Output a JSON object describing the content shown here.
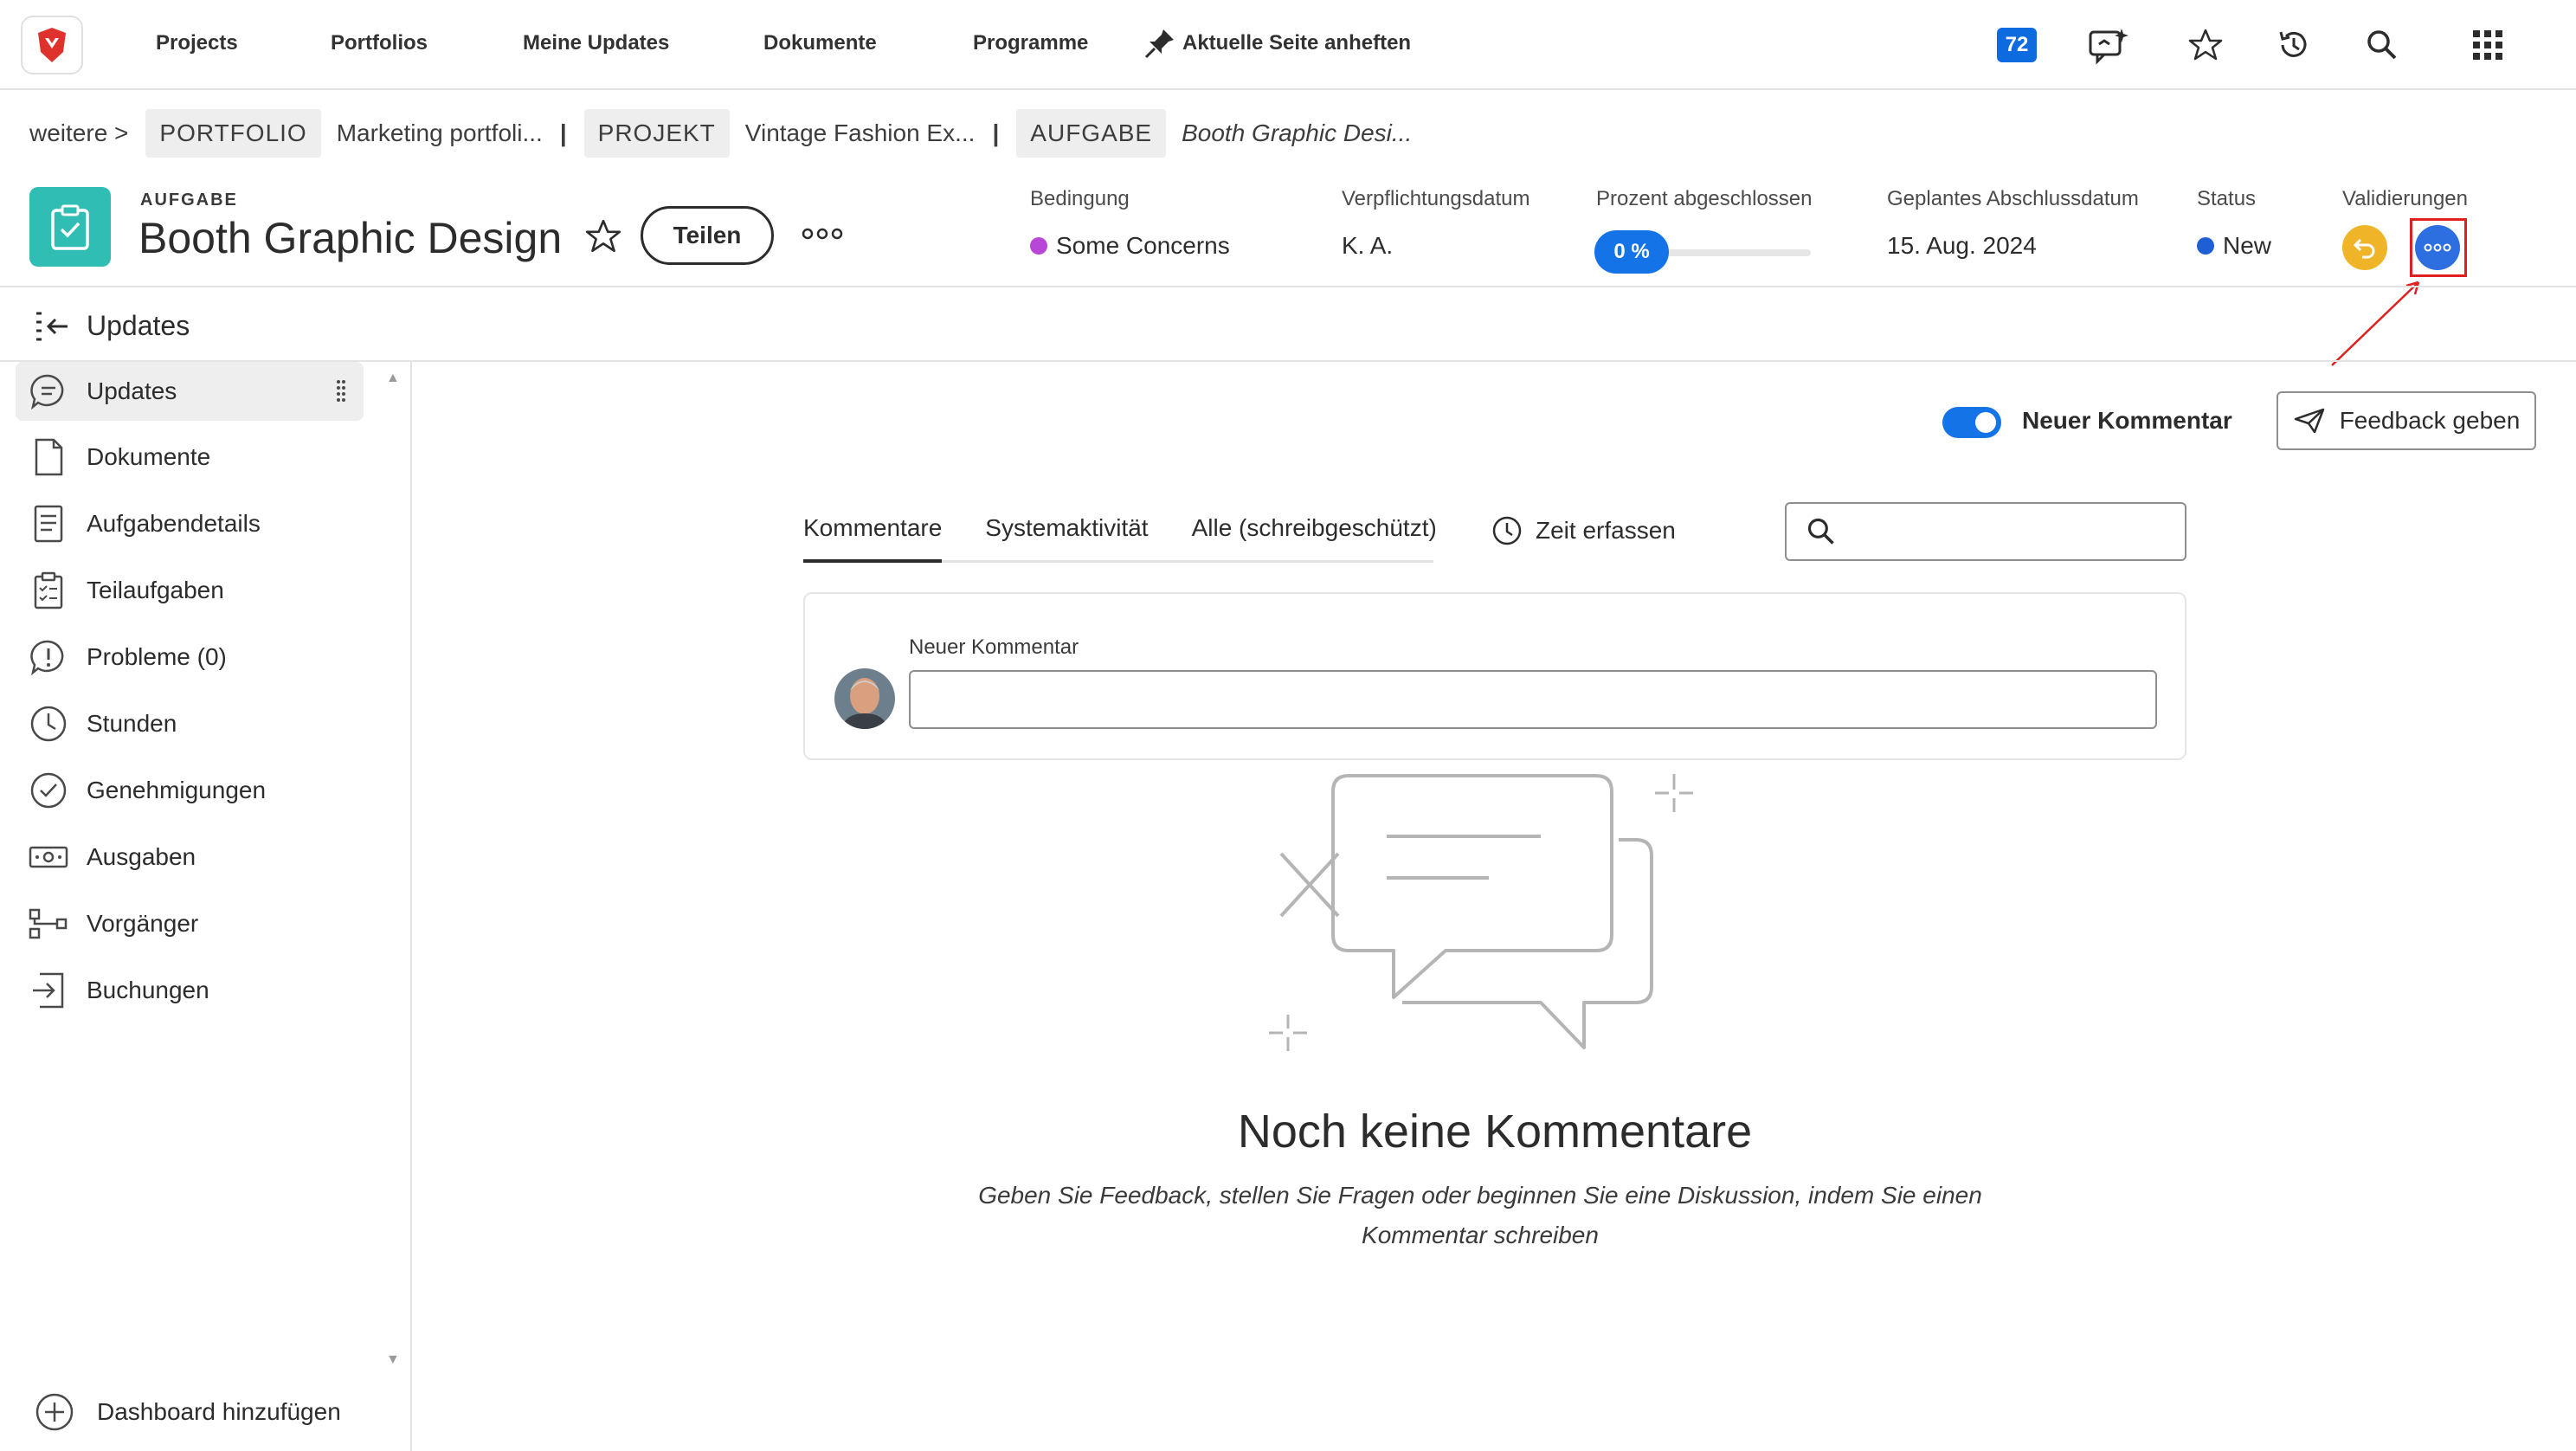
{
  "nav": {
    "links": [
      "Projects",
      "Portfolios",
      "Meine Updates",
      "Dokumente",
      "Programme"
    ],
    "pin_label": "Aktuelle Seite anheften",
    "notification_count": "72"
  },
  "breadcrumb": {
    "more": "weitere >",
    "portfolio_chip": "PORTFOLIO",
    "portfolio_name": "Marketing portfoli...",
    "project_chip": "PROJEKT",
    "project_name": "Vintage Fashion Ex...",
    "task_chip": "AUFGABE",
    "task_name": "Booth Graphic Desi..."
  },
  "header": {
    "kind": "AUFGABE",
    "title": "Booth Graphic Design",
    "share_label": "Teilen",
    "fields": {
      "condition_label": "Bedingung",
      "condition_value": "Some Concerns",
      "condition_color": "#b846d6",
      "commit_label": "Verpflichtungsdatum",
      "commit_value": "K. A.",
      "percent_label": "Prozent abgeschlossen",
      "percent_value": "0 %",
      "percent_fraction": 0,
      "planned_label": "Geplantes Abschlussdatum",
      "planned_value": "15. Aug. 2024",
      "status_label": "Status",
      "status_value": "New",
      "status_color": "#1f5fd6",
      "validations_label": "Validierungen"
    }
  },
  "updates_bar": {
    "title": "Updates"
  },
  "sidebar": {
    "items": [
      {
        "label": "Updates",
        "icon": "comment-icon"
      },
      {
        "label": "Dokumente",
        "icon": "document-icon"
      },
      {
        "label": "Aufgabendetails",
        "icon": "details-icon"
      },
      {
        "label": "Teilaufgaben",
        "icon": "subtasks-icon"
      },
      {
        "label": "Probleme (0)",
        "icon": "issue-icon"
      },
      {
        "label": "Stunden",
        "icon": "clock-icon"
      },
      {
        "label": "Genehmigungen",
        "icon": "approval-icon"
      },
      {
        "label": "Ausgaben",
        "icon": "expense-icon"
      },
      {
        "label": "Vorgänger",
        "icon": "predecessor-icon"
      },
      {
        "label": "Buchungen",
        "icon": "booking-icon"
      }
    ],
    "add_dashboard": "Dashboard hinzufügen"
  },
  "main": {
    "toggle_label": "Neuer Kommentar",
    "feedback_label": "Feedback geben",
    "tabs": [
      "Kommentare",
      "Systemaktivität",
      "Alle (schreibgeschützt)"
    ],
    "time_log": "Zeit erfassen",
    "comment_label": "Neuer Kommentar",
    "empty_title": "Noch keine Kommentare",
    "empty_subtitle": "Geben Sie Feedback, stellen Sie Fragen oder beginnen Sie eine Diskussion, indem Sie einen Kommentar schreiben"
  },
  "colors": {
    "accent": "#1473e6",
    "task_icon": "#2fbdb4",
    "highlight": "#e02020"
  }
}
